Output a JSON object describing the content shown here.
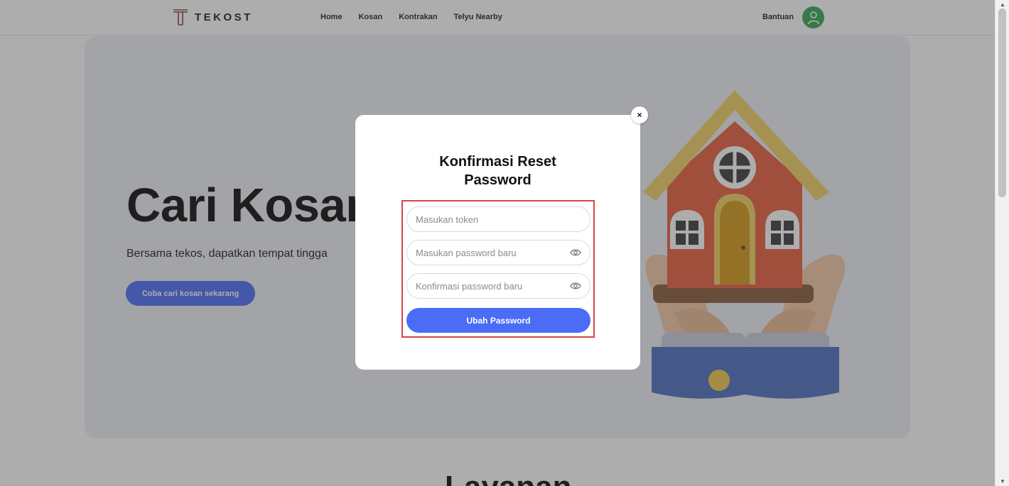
{
  "navbar": {
    "brand": "TEKOST",
    "links": [
      "Home",
      "Kosan",
      "Kontrakan",
      "Telyu Nearby"
    ],
    "help": "Bantuan"
  },
  "hero": {
    "title": "Cari Kosan",
    "subtitle": "Bersama tekos, dapatkan tempat tingga",
    "cta": "Coba cari kosan sekarang"
  },
  "next_section_title": "Layanan",
  "modal": {
    "title_line1": "Konfirmasi Reset",
    "title_line2": "Password",
    "close_label": "×",
    "token_placeholder": "Masukan token",
    "new_password_placeholder": "Masukan password baru",
    "confirm_password_placeholder": "Konfirmasi password baru",
    "submit_label": "Ubah Password"
  },
  "colors": {
    "accent": "#4a6cf7",
    "avatar": "#34a853",
    "highlight_frame": "#d64545"
  },
  "icons": {
    "logo": "tekost-logo-icon",
    "avatar": "user-icon",
    "eye": "eye-icon",
    "close": "close-icon"
  }
}
